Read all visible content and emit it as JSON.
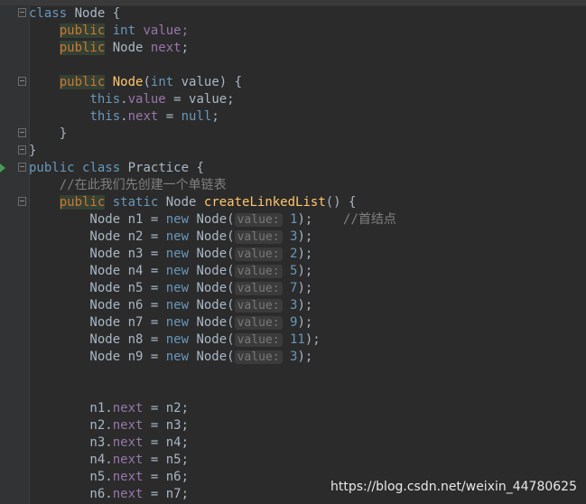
{
  "editor": {
    "lines": [
      [
        {
          "t": "class",
          "c": "kw-blue"
        },
        {
          "t": " Node {",
          "c": "plain"
        }
      ],
      [
        {
          "t": "    ",
          "c": "plain"
        },
        {
          "t": "public",
          "c": "hl"
        },
        {
          "t": " ",
          "c": "plain"
        },
        {
          "t": "int",
          "c": "kw-blue"
        },
        {
          "t": " value;",
          "c": "field"
        }
      ],
      [
        {
          "t": "    ",
          "c": "plain"
        },
        {
          "t": "public",
          "c": "hl"
        },
        {
          "t": " Node ",
          "c": "plain"
        },
        {
          "t": "next",
          "c": "field"
        },
        {
          "t": ";",
          "c": "plain"
        }
      ],
      [],
      [
        {
          "t": "    ",
          "c": "plain"
        },
        {
          "t": "public",
          "c": "hl"
        },
        {
          "t": " ",
          "c": "plain"
        },
        {
          "t": "Node",
          "c": "fn"
        },
        {
          "t": "(",
          "c": "plain"
        },
        {
          "t": "int",
          "c": "kw-blue"
        },
        {
          "t": " value) {",
          "c": "plain"
        }
      ],
      [
        {
          "t": "        ",
          "c": "plain"
        },
        {
          "t": "this",
          "c": "kw-blue"
        },
        {
          "t": ".",
          "c": "plain"
        },
        {
          "t": "value",
          "c": "field"
        },
        {
          "t": " = value;",
          "c": "plain"
        }
      ],
      [
        {
          "t": "        ",
          "c": "plain"
        },
        {
          "t": "this",
          "c": "kw-blue"
        },
        {
          "t": ".",
          "c": "plain"
        },
        {
          "t": "next",
          "c": "field"
        },
        {
          "t": " = ",
          "c": "plain"
        },
        {
          "t": "null",
          "c": "kw-blue"
        },
        {
          "t": ";",
          "c": "plain"
        }
      ],
      [
        {
          "t": "    }",
          "c": "plain"
        }
      ],
      [
        {
          "t": "}",
          "c": "plain"
        }
      ],
      [
        {
          "t": "public",
          "c": "kw-blue"
        },
        {
          "t": " ",
          "c": "plain"
        },
        {
          "t": "class",
          "c": "kw-blue"
        },
        {
          "t": " Practice {",
          "c": "plain"
        }
      ],
      [
        {
          "t": "    //在此我们先创建一个单链表",
          "c": "comment"
        }
      ],
      [
        {
          "t": "    ",
          "c": "plain"
        },
        {
          "t": "public",
          "c": "hl"
        },
        {
          "t": " ",
          "c": "plain"
        },
        {
          "t": "static",
          "c": "kw-blue"
        },
        {
          "t": " Node ",
          "c": "plain"
        },
        {
          "t": "createLinkedList",
          "c": "fn"
        },
        {
          "t": "() {",
          "c": "plain"
        }
      ],
      [
        {
          "t": "        Node n1 = ",
          "c": "plain"
        },
        {
          "t": "new",
          "c": "kw-blue"
        },
        {
          "t": " Node(",
          "c": "plain"
        },
        {
          "t": "value:",
          "c": "hint"
        },
        {
          "t": " ",
          "c": "plain"
        },
        {
          "t": "1",
          "c": "num"
        },
        {
          "t": ");    ",
          "c": "plain"
        },
        {
          "t": "//首结点",
          "c": "comment"
        }
      ],
      [
        {
          "t": "        Node n2 = ",
          "c": "plain"
        },
        {
          "t": "new",
          "c": "kw-blue"
        },
        {
          "t": " Node(",
          "c": "plain"
        },
        {
          "t": "value:",
          "c": "hint"
        },
        {
          "t": " ",
          "c": "plain"
        },
        {
          "t": "3",
          "c": "num"
        },
        {
          "t": ");",
          "c": "plain"
        }
      ],
      [
        {
          "t": "        Node n3 = ",
          "c": "plain"
        },
        {
          "t": "new",
          "c": "kw-blue"
        },
        {
          "t": " Node(",
          "c": "plain"
        },
        {
          "t": "value:",
          "c": "hint"
        },
        {
          "t": " ",
          "c": "plain"
        },
        {
          "t": "2",
          "c": "num"
        },
        {
          "t": ");",
          "c": "plain"
        }
      ],
      [
        {
          "t": "        Node n4 = ",
          "c": "plain"
        },
        {
          "t": "new",
          "c": "kw-blue"
        },
        {
          "t": " Node(",
          "c": "plain"
        },
        {
          "t": "value:",
          "c": "hint"
        },
        {
          "t": " ",
          "c": "plain"
        },
        {
          "t": "5",
          "c": "num"
        },
        {
          "t": ");",
          "c": "plain"
        }
      ],
      [
        {
          "t": "        Node n5 = ",
          "c": "plain"
        },
        {
          "t": "new",
          "c": "kw-blue"
        },
        {
          "t": " Node(",
          "c": "plain"
        },
        {
          "t": "value:",
          "c": "hint"
        },
        {
          "t": " ",
          "c": "plain"
        },
        {
          "t": "7",
          "c": "num"
        },
        {
          "t": ");",
          "c": "plain"
        }
      ],
      [
        {
          "t": "        Node n6 = ",
          "c": "plain"
        },
        {
          "t": "new",
          "c": "kw-blue"
        },
        {
          "t": " Node(",
          "c": "plain"
        },
        {
          "t": "value:",
          "c": "hint"
        },
        {
          "t": " ",
          "c": "plain"
        },
        {
          "t": "3",
          "c": "num"
        },
        {
          "t": ");",
          "c": "plain"
        }
      ],
      [
        {
          "t": "        Node n7 = ",
          "c": "plain"
        },
        {
          "t": "new",
          "c": "kw-blue"
        },
        {
          "t": " Node(",
          "c": "plain"
        },
        {
          "t": "value:",
          "c": "hint"
        },
        {
          "t": " ",
          "c": "plain"
        },
        {
          "t": "9",
          "c": "num"
        },
        {
          "t": ");",
          "c": "plain"
        }
      ],
      [
        {
          "t": "        Node n8 = ",
          "c": "plain"
        },
        {
          "t": "new",
          "c": "kw-blue"
        },
        {
          "t": " Node(",
          "c": "plain"
        },
        {
          "t": "value:",
          "c": "hint"
        },
        {
          "t": " ",
          "c": "plain"
        },
        {
          "t": "11",
          "c": "num"
        },
        {
          "t": ");",
          "c": "plain"
        }
      ],
      [
        {
          "t": "        Node n9 = ",
          "c": "plain"
        },
        {
          "t": "new",
          "c": "kw-blue"
        },
        {
          "t": " Node(",
          "c": "plain"
        },
        {
          "t": "value:",
          "c": "hint"
        },
        {
          "t": " ",
          "c": "plain"
        },
        {
          "t": "3",
          "c": "num"
        },
        {
          "t": ");",
          "c": "plain"
        }
      ],
      [],
      [],
      [
        {
          "t": "        n1.",
          "c": "plain"
        },
        {
          "t": "next",
          "c": "field"
        },
        {
          "t": " = n2;",
          "c": "plain"
        }
      ],
      [
        {
          "t": "        n2.",
          "c": "plain"
        },
        {
          "t": "next",
          "c": "field"
        },
        {
          "t": " = n3;",
          "c": "plain"
        }
      ],
      [
        {
          "t": "        n3.",
          "c": "plain"
        },
        {
          "t": "next",
          "c": "field"
        },
        {
          "t": " = n4;",
          "c": "plain"
        }
      ],
      [
        {
          "t": "        n4.",
          "c": "plain"
        },
        {
          "t": "next",
          "c": "field"
        },
        {
          "t": " = n5;",
          "c": "plain"
        }
      ],
      [
        {
          "t": "        n5.",
          "c": "plain"
        },
        {
          "t": "next",
          "c": "field"
        },
        {
          "t": " = n6;",
          "c": "plain"
        }
      ],
      [
        {
          "t": "        n6.",
          "c": "plain"
        },
        {
          "t": "next",
          "c": "field"
        },
        {
          "t": " = n7;",
          "c": "plain"
        }
      ]
    ]
  },
  "colors": {
    "background": "#2b2b2b",
    "gutter": "#313335",
    "plain": "#a9b7c6",
    "keyword": "#6897bb",
    "field": "#9876aa",
    "function": "#ffc66d",
    "comment": "#808080",
    "highlight": "#344134"
  },
  "watermark": "https://blog.csdn.net/weixin_44780625"
}
